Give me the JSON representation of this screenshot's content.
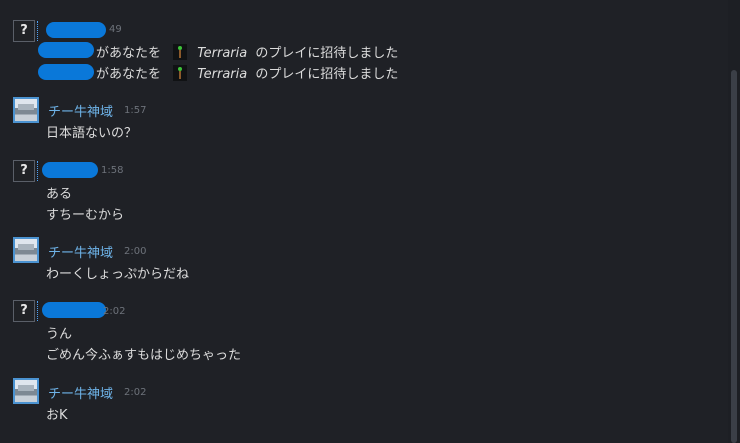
{
  "messages": [
    {
      "sender": "",
      "time": "49",
      "lines": [],
      "invites": [
        {
          "prefix": "があなたを",
          "game": "Terraria",
          "suffix": "のプレイに招待しました"
        },
        {
          "prefix": "があなたを",
          "game": "Terraria",
          "suffix": "のプレイに招待しました"
        }
      ]
    },
    {
      "sender": "チー牛神域",
      "time": "1:57",
      "lines": [
        "日本語ないの？"
      ]
    },
    {
      "sender": "",
      "time": "1:58",
      "lines": [
        "ある",
        "すちーむから"
      ]
    },
    {
      "sender": "チー牛神域",
      "time": "2:00",
      "lines": [
        "わーくしょっぷからだね"
      ]
    },
    {
      "sender": "",
      "time": "2:02",
      "lines": [
        "うん",
        "ごめん今ふぁすもはじめちゃった"
      ]
    },
    {
      "sender": "チー牛神域",
      "time": "2:02",
      "lines": [
        "おK"
      ]
    }
  ],
  "colors": {
    "background": "#1f2126",
    "sender_name": "#6eb3e8",
    "redaction": "#0a78d9"
  },
  "icons": {
    "unknown_avatar": "question-mark",
    "game": "terraria-tree-icon"
  }
}
